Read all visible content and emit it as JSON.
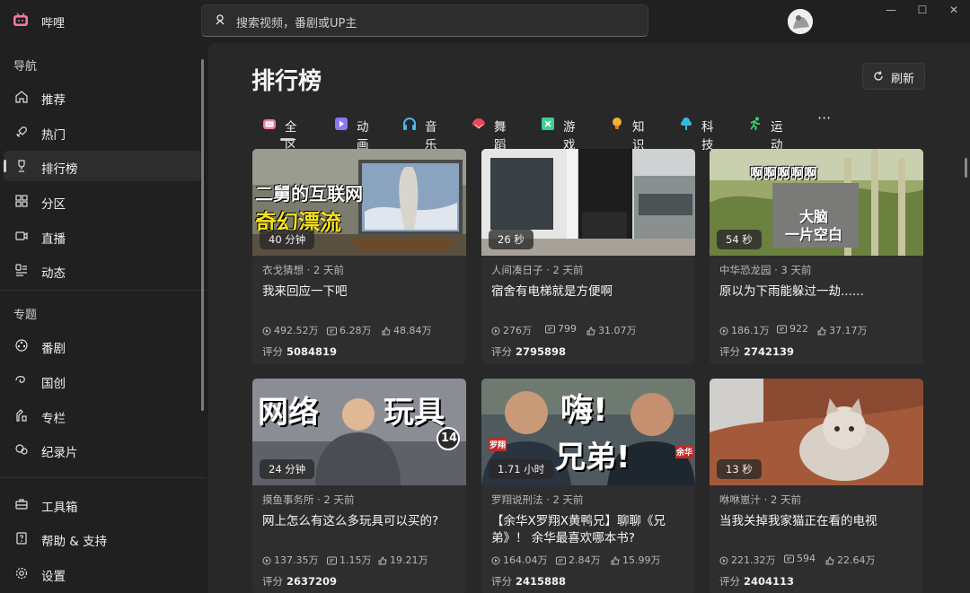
{
  "app": {
    "title": "哔哩"
  },
  "search": {
    "placeholder": "搜索视频，番剧或UP主"
  },
  "window_controls": {
    "minimize": "—",
    "maximize": "☐",
    "close": "✕"
  },
  "sidebar": {
    "nav_heading": "导航",
    "nav_items": [
      {
        "label": "推荐",
        "icon": "home-icon"
      },
      {
        "label": "热门",
        "icon": "rocket-icon"
      },
      {
        "label": "排行榜",
        "icon": "trophy-icon",
        "active": true
      },
      {
        "label": "分区",
        "icon": "grid-icon"
      },
      {
        "label": "直播",
        "icon": "video-camera-icon"
      },
      {
        "label": "动态",
        "icon": "activity-icon"
      }
    ],
    "topic_heading": "专题",
    "topic_items": [
      {
        "label": "番剧",
        "icon": "film-reel-icon"
      },
      {
        "label": "国创",
        "icon": "swirl-icon"
      },
      {
        "label": "专栏",
        "icon": "column-icon"
      },
      {
        "label": "纪录片",
        "icon": "documentary-icon"
      }
    ],
    "bottom_items": [
      {
        "label": "工具箱",
        "icon": "toolbox-icon"
      },
      {
        "label": "帮助 & 支持",
        "icon": "help-icon"
      },
      {
        "label": "设置",
        "icon": "gear-icon"
      }
    ]
  },
  "main": {
    "title": "排行榜",
    "refresh_label": "刷新",
    "tabs": [
      {
        "label": "全区",
        "icon": "tv-icon",
        "color": "#f07ca0",
        "active": true
      },
      {
        "label": "动画",
        "icon": "play-icon",
        "color": "#8a7af0"
      },
      {
        "label": "音乐",
        "icon": "headphones-icon",
        "color": "#4ab8e8"
      },
      {
        "label": "舞蹈",
        "icon": "fan-icon",
        "color": "#e8485a"
      },
      {
        "label": "游戏",
        "icon": "gamepad-icon",
        "color": "#3ccf8e"
      },
      {
        "label": "知识",
        "icon": "lightbulb-icon",
        "color": "#f0b030"
      },
      {
        "label": "科技",
        "icon": "cloud-icon",
        "color": "#38b8e0"
      },
      {
        "label": "运动",
        "icon": "runner-icon",
        "color": "#3ccf6e"
      }
    ],
    "more_label": "···",
    "videos": [
      {
        "duration": "40 分钟",
        "author": "衣戈猜想 · 2 天前",
        "title": "我来回应一下吧",
        "views": "492.52万",
        "danmaku": "6.28万",
        "likes": "48.84万",
        "score_label": "评分",
        "score": "5084819",
        "overlay": [
          "二舅的互联网",
          "奇幻漂流"
        ]
      },
      {
        "duration": "26 秒",
        "author": "人间凑日子 · 2 天前",
        "title": "宿舍有电梯就是方便啊",
        "views": "276万",
        "danmaku": "799",
        "likes": "31.07万",
        "score_label": "评分",
        "score": "2795898",
        "overlay": []
      },
      {
        "duration": "54 秒",
        "author": "中华恐龙园 · 3 天前",
        "title": "原以为下雨能躲过一劫......",
        "views": "186.1万",
        "danmaku": "922",
        "likes": "37.17万",
        "score_label": "评分",
        "score": "2742139",
        "overlay": [
          "啊啊啊啊啊",
          "大脑",
          "一片空白"
        ]
      },
      {
        "duration": "24 分钟",
        "author": "摸鱼事务所 · 2 天前",
        "title": "网上怎么有这么多玩具可以买的?",
        "views": "137.35万",
        "danmaku": "1.15万",
        "likes": "19.21万",
        "score_label": "评分",
        "score": "2637209",
        "overlay": [
          "网络",
          "玩具",
          "14"
        ]
      },
      {
        "duration": "1.71 小时",
        "author": "罗翔说刑法 · 2 天前",
        "title": "【余华X罗翔X黄鸭兄】聊聊《兄弟》！ 余华最喜欢哪本书?",
        "views": "164.04万",
        "danmaku": "2.84万",
        "likes": "15.99万",
        "score_label": "评分",
        "score": "2415888",
        "overlay": [
          "嗨!",
          "兄弟!",
          "罗翔",
          "余华"
        ]
      },
      {
        "duration": "13 秒",
        "author": "咻咻崽汁 · 2 天前",
        "title": "当我关掉我家猫正在看的电视",
        "views": "221.32万",
        "danmaku": "594",
        "likes": "22.64万",
        "score_label": "评分",
        "score": "2404113",
        "overlay": []
      }
    ]
  }
}
